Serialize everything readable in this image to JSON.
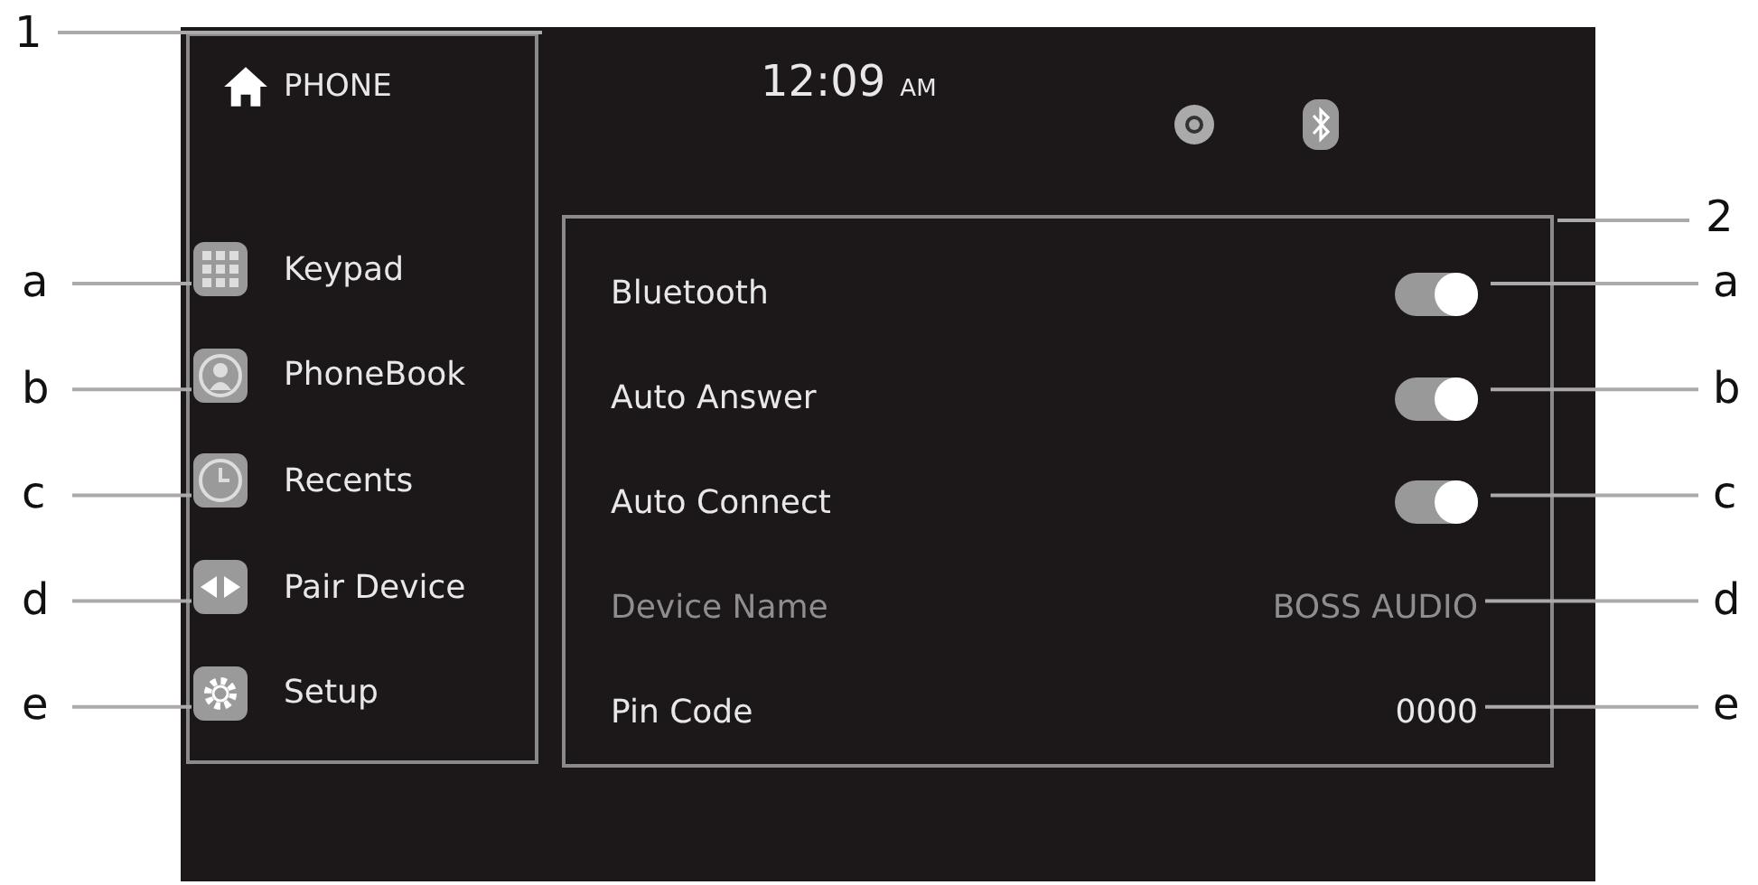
{
  "header": {
    "title": "PHONE",
    "time": "12:09",
    "meridiem": "AM"
  },
  "menu": [
    {
      "label": "Keypad",
      "kind": "keypad"
    },
    {
      "label": "PhoneBook",
      "kind": "contacts"
    },
    {
      "label": "Recents",
      "kind": "recents"
    },
    {
      "label": "Pair Device",
      "kind": "pair"
    },
    {
      "label": "Setup",
      "kind": "setup"
    }
  ],
  "settings": [
    {
      "label": "Bluetooth",
      "kind": "toggle",
      "on": true
    },
    {
      "label": "Auto Answer",
      "kind": "toggle",
      "on": true
    },
    {
      "label": "Auto Connect",
      "kind": "toggle",
      "on": true
    },
    {
      "label": "Device Name",
      "kind": "value",
      "value": "BOSS AUDIO",
      "disabled": true
    },
    {
      "label": "Pin Code",
      "kind": "value",
      "value": "0000",
      "disabled": false
    }
  ],
  "callouts": {
    "sections": [
      "1",
      "2"
    ],
    "left": [
      "a",
      "b",
      "c",
      "d",
      "e"
    ],
    "right": [
      "a",
      "b",
      "c",
      "d",
      "e"
    ]
  }
}
